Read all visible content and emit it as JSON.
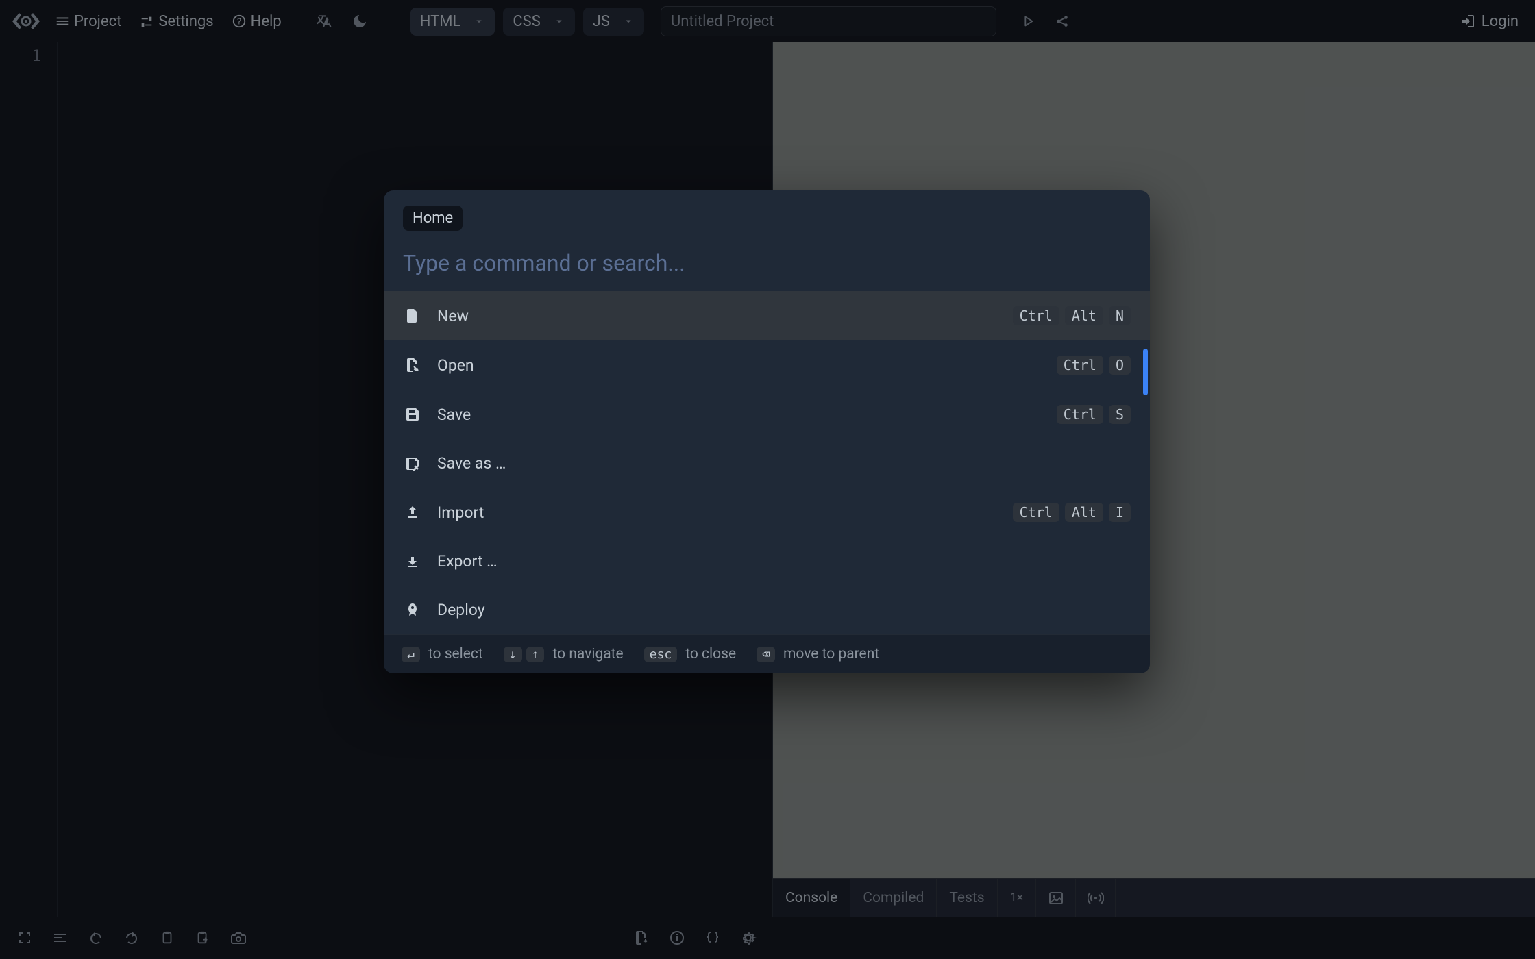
{
  "topbar": {
    "menu": {
      "project": "Project",
      "settings": "Settings",
      "help": "Help"
    },
    "tabs": [
      {
        "label": "HTML",
        "active": true
      },
      {
        "label": "CSS",
        "active": false
      },
      {
        "label": "JS",
        "active": false
      }
    ],
    "project_title": "Untitled Project",
    "login": "Login"
  },
  "editor": {
    "first_line_no": "1"
  },
  "preview": {
    "tabs": {
      "console": "Console",
      "compiled": "Compiled",
      "tests": "Tests",
      "zoom": "1×"
    }
  },
  "palette": {
    "breadcrumb": "Home",
    "search_placeholder": "Type a command or search...",
    "items": [
      {
        "id": "new",
        "label": "New",
        "keys": [
          "Ctrl",
          "Alt",
          "N"
        ]
      },
      {
        "id": "open",
        "label": "Open",
        "keys": [
          "Ctrl",
          "O"
        ]
      },
      {
        "id": "save",
        "label": "Save",
        "keys": [
          "Ctrl",
          "S"
        ]
      },
      {
        "id": "saveas",
        "label": "Save as …",
        "keys": []
      },
      {
        "id": "import",
        "label": "Import",
        "keys": [
          "Ctrl",
          "Alt",
          "I"
        ]
      },
      {
        "id": "export",
        "label": "Export …",
        "keys": []
      },
      {
        "id": "deploy",
        "label": "Deploy",
        "keys": []
      }
    ],
    "footer": {
      "select": "to select",
      "navigate": "to navigate",
      "close": "to close",
      "parent": "move to parent",
      "esc": "esc"
    }
  }
}
